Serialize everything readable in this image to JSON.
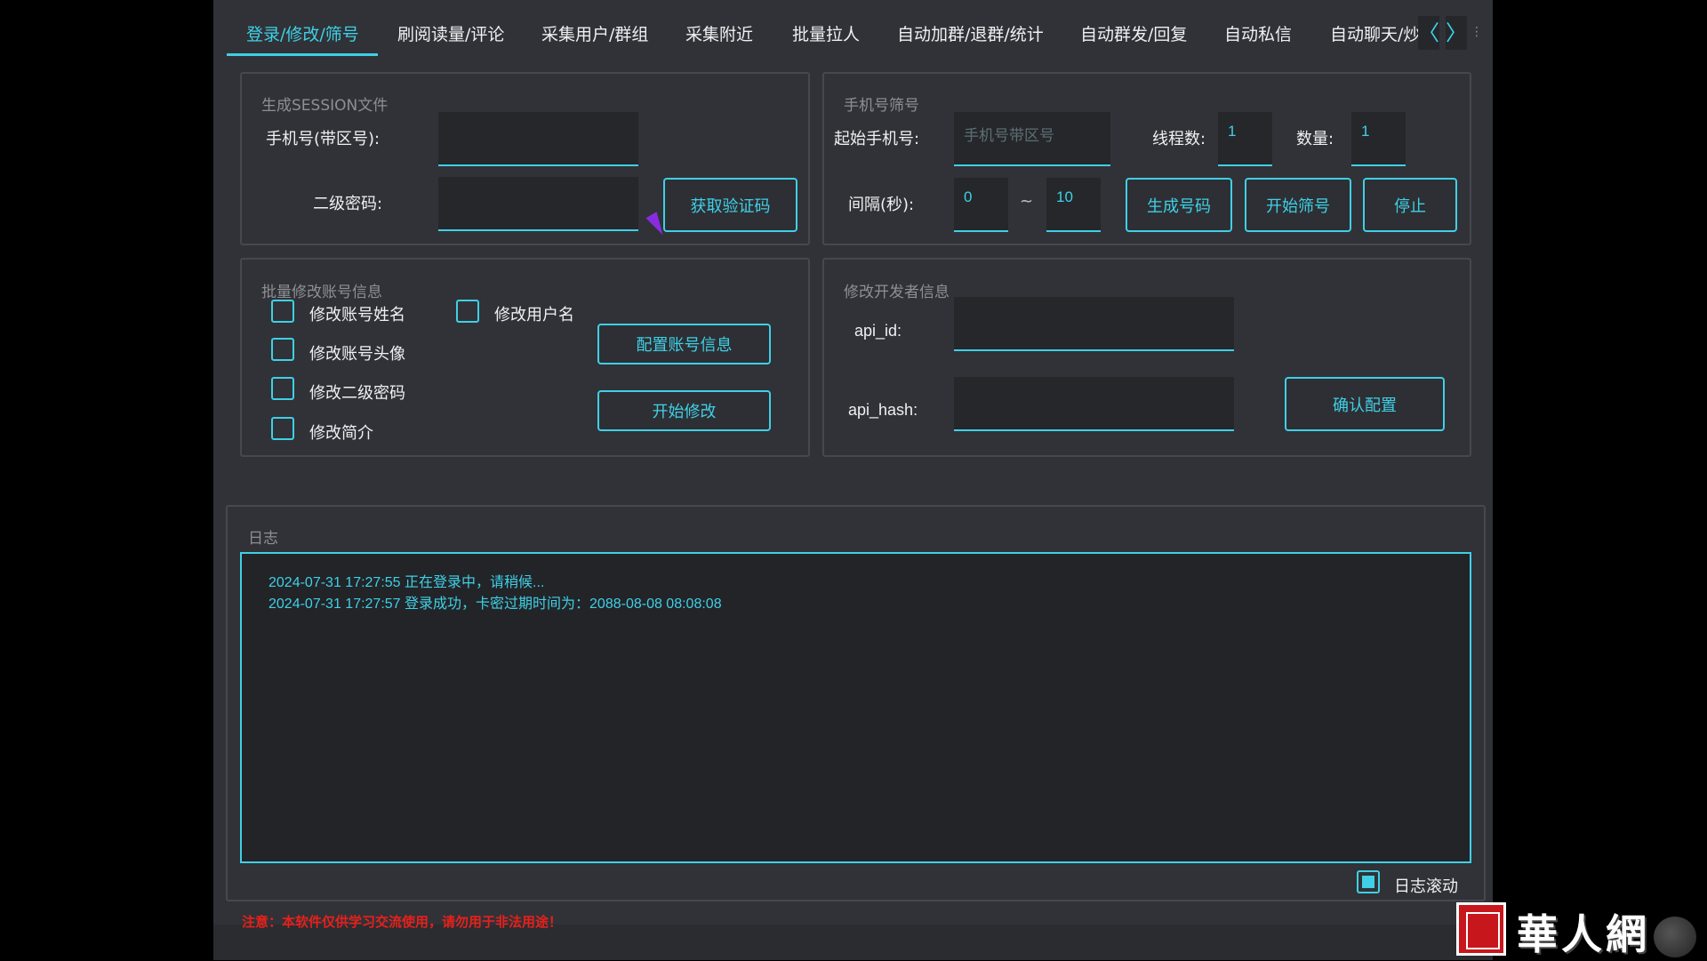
{
  "tabs": [
    {
      "label": "登录/修改/筛号",
      "active": true
    },
    {
      "label": "刷阅读量/评论"
    },
    {
      "label": "采集用户/群组"
    },
    {
      "label": "采集附近"
    },
    {
      "label": "批量拉人"
    },
    {
      "label": "自动加群/退群/统计"
    },
    {
      "label": "自动群发/回复"
    },
    {
      "label": "自动私信"
    },
    {
      "label": "自动聊天/炒"
    }
  ],
  "tab_nav": {
    "prev": "〈",
    "next": "〉",
    "more": "⋮"
  },
  "session": {
    "title": "生成SESSION文件",
    "phone_label": "手机号(带区号):",
    "phone_value": "",
    "password_label": "二级密码:",
    "password_value": "",
    "get_code_button": "获取验证码"
  },
  "phone_filter": {
    "title": "手机号筛号",
    "start_label": "起始手机号:",
    "start_placeholder": "手机号带区号",
    "threads_label": "线程数:",
    "threads_value": "1",
    "count_label": "数量:",
    "count_value": "1",
    "interval_label": "间隔(秒):",
    "interval_min": "0",
    "interval_sep": "~",
    "interval_max": "10",
    "generate_button": "生成号码",
    "start_button": "开始筛号",
    "stop_button": "停止"
  },
  "batch_modify": {
    "title": "批量修改账号信息",
    "options": [
      {
        "label": "修改账号姓名",
        "checked": false
      },
      {
        "label": "修改用户名",
        "checked": false
      },
      {
        "label": "修改账号头像",
        "checked": false
      },
      {
        "label": "修改二级密码",
        "checked": false
      },
      {
        "label": "修改简介",
        "checked": false
      }
    ],
    "config_button": "配置账号信息",
    "start_button": "开始修改"
  },
  "developer": {
    "title": "修改开发者信息",
    "api_id_label": "api_id:",
    "api_id_value": "",
    "api_hash_label": "api_hash:",
    "api_hash_value": "",
    "confirm_button": "确认配置"
  },
  "log": {
    "title": "日志",
    "lines": [
      "2024-07-31 17:27:55 正在登录中，请稍候...",
      "2024-07-31 17:27:57 登录成功，卡密过期时间为：2088-08-08 08:08:08"
    ],
    "scroll_label": "日志滚动",
    "scroll_checked": true
  },
  "warning": "注意：本软件仅供学习交流使用，请勿用于非法用途！",
  "watermark": {
    "text": "華人網"
  },
  "colors": {
    "accent": "#3fd0e6",
    "background": "#303237",
    "warning": "#e8201b"
  }
}
